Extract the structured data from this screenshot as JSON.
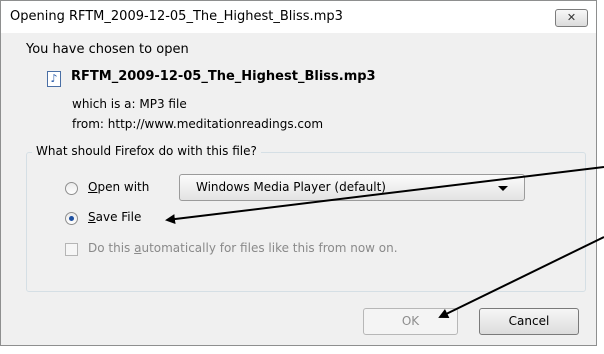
{
  "window": {
    "title": "Opening RFTM_2009-12-05_The_Highest_Bliss.mp3",
    "close_label": "✕"
  },
  "content": {
    "intro": "You have chosen to open",
    "filename": "RFTM_2009-12-05_The_Highest_Bliss.mp3",
    "file_icon": "audio-file-icon",
    "which_is": "which is a:  MP3 file",
    "from": "from:  http://www.meditationreadings.com"
  },
  "action_group": {
    "legend": "What should Firefox do with this file?",
    "open_with": {
      "access_key": "O",
      "label_rest": "pen with",
      "selected": false
    },
    "open_with_app": "Windows Media Player (default)",
    "save_file": {
      "access_key": "S",
      "label_rest": "ave File",
      "selected": true
    },
    "auto_checkbox": {
      "label_before": "Do this ",
      "access_key": "a",
      "label_after": "utomatically for files like this from now on.",
      "checked": false,
      "enabled": false
    }
  },
  "buttons": {
    "ok": "OK",
    "cancel": "Cancel"
  },
  "annotation": {
    "arrow_color": "#000000"
  }
}
